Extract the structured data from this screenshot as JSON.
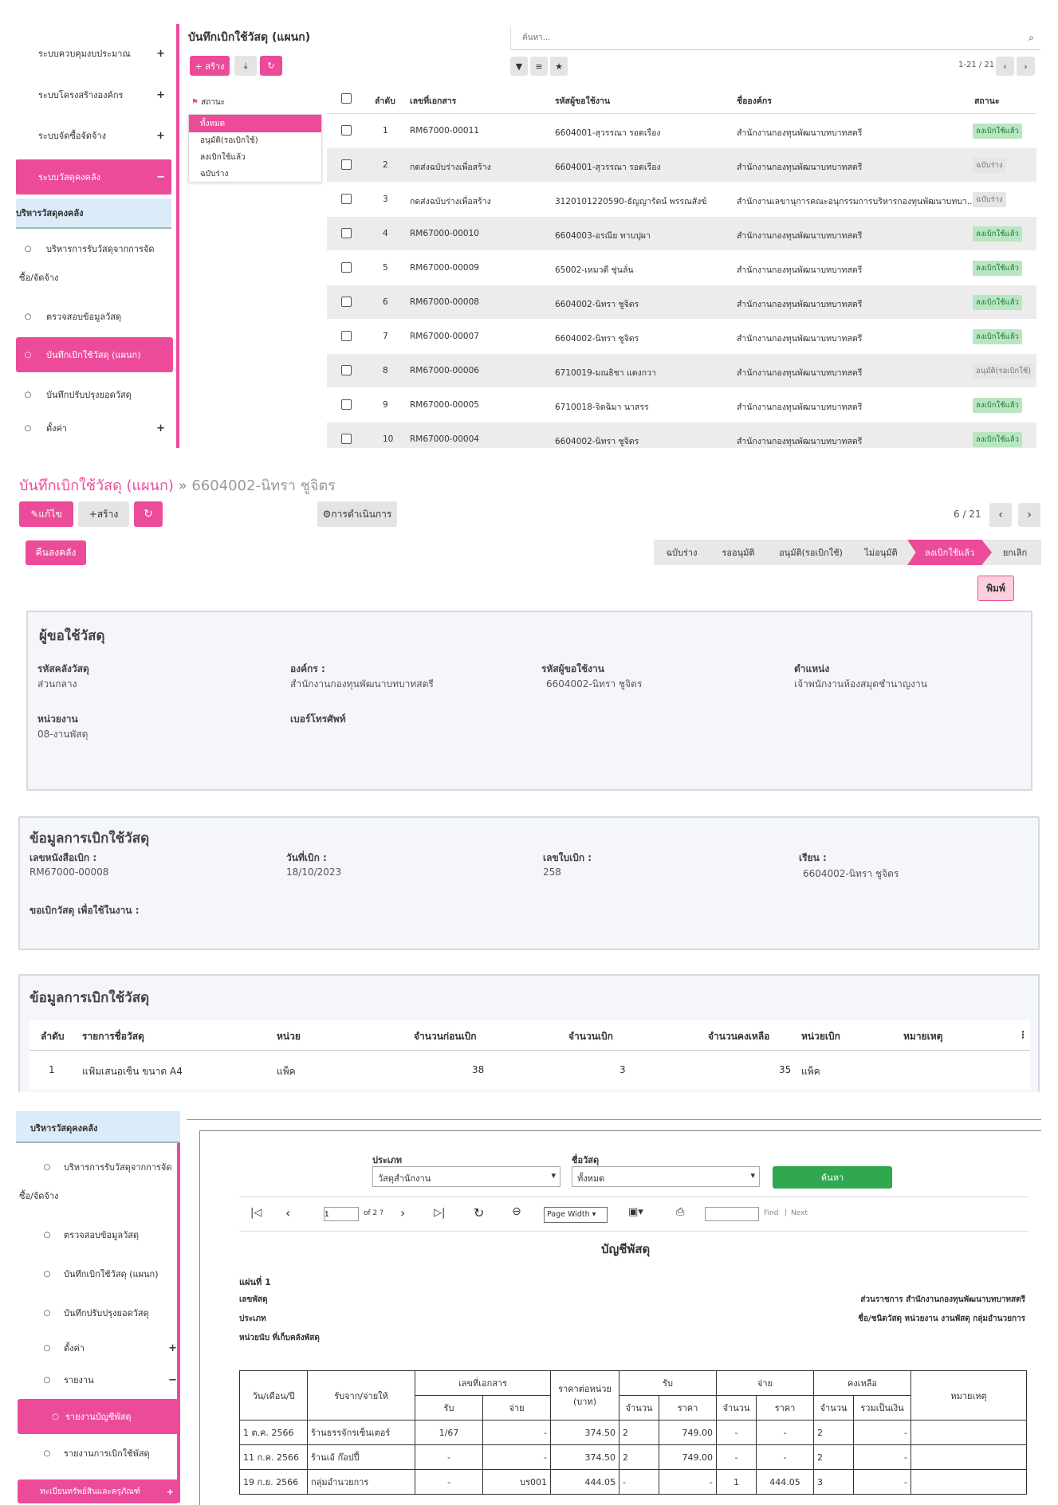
{
  "screen1": {
    "sidebar": [
      {
        "label": "ระบบควบคุมงบประมาณ",
        "sign": "+"
      },
      {
        "label": "ระบบโครงสร้างองค์กร",
        "sign": "+"
      },
      {
        "label": "ระบบจัดซื้อจัดจ้าง",
        "sign": "+"
      },
      {
        "label": "ระบบวัสดุคงคลัง",
        "sign": "−"
      }
    ],
    "sub_header": "บริหารวัสดุคงคลัง",
    "sub_items": [
      "บริหารการรับวัสดุจากการจัด",
      "ซื้อ/จัดจ้าง",
      "ตรวจสอบข้อมูลวัสดุ",
      "บันทึกเบิกใช้วัสดุ (แผนก)",
      "บันทึกปรับปรุงยอดวัสดุ",
      "ตั้งค่า"
    ],
    "title": "บันทึกเบิกใช้วัสดุ (แผนก)",
    "search_placeholder": "ค้นหา...",
    "create_label": "+ สร้าง",
    "pager": "1-21 / 21",
    "status_title": "สถานะ",
    "status_items": [
      "ทั้งหมด",
      "อนุมัติ(รอเบิกใช้)",
      "ลงเบิกใช้แล้ว",
      "ฉบับร่าง"
    ],
    "columns": [
      "ลำดับ",
      "เลขที่เอกสาร",
      "รหัสผู้ขอใช้งาน",
      "ชื่อองค์กร",
      "สถานะ"
    ],
    "rows": [
      {
        "n": "1",
        "doc": "RM67000-00011",
        "user": "6604001-สุวรรณา รอดเรือง",
        "org": "สำนักงานกองทุนพัฒนาบทบาทสตรี",
        "status": "ลงเบิกใช้แล้ว",
        "kind": "ok"
      },
      {
        "n": "2",
        "doc": "กดส่งฉบับร่างเพื่อสร้าง",
        "user": "6604001-สุวรรณา รอดเรือง",
        "org": "สำนักงานกองทุนพัฒนาบทบาทสตรี",
        "status": "ฉบับร่าง",
        "kind": "dr"
      },
      {
        "n": "3",
        "doc": "กดส่งฉบับร่างเพื่อสร้าง",
        "user": "3120101220590-ธัญญารัตน์ พรรณสังข์",
        "org": "สำนักงานเลขานุการคณะอนุกรรมการบริหารกองทุนพัฒนาบทบา...",
        "status": "ฉบับร่าง",
        "kind": "dr"
      },
      {
        "n": "4",
        "doc": "RM67000-00010",
        "user": "6604003-อรณีย ทาบปุผา",
        "org": "สำนักงานกองทุนพัฒนาบทบาทสตรี",
        "status": "ลงเบิกใช้แล้ว",
        "kind": "ok"
      },
      {
        "n": "5",
        "doc": "RM67000-00009",
        "user": "65002-เหมวดี ชุ่นลั่น",
        "org": "สำนักงานกองทุนพัฒนาบทบาทสตรี",
        "status": "ลงเบิกใช้แล้ว",
        "kind": "ok"
      },
      {
        "n": "6",
        "doc": "RM67000-00008",
        "user": "6604002-นิทรา ชูจิตร",
        "org": "สำนักงานกองทุนพัฒนาบทบาทสตรี",
        "status": "ลงเบิกใช้แล้ว",
        "kind": "ok"
      },
      {
        "n": "7",
        "doc": "RM67000-00007",
        "user": "6604002-นิทรา ชูจิตร",
        "org": "สำนักงานกองทุนพัฒนาบทบาทสตรี",
        "status": "ลงเบิกใช้แล้ว",
        "kind": "ok"
      },
      {
        "n": "8",
        "doc": "RM67000-00006",
        "user": "6710019-มณธิชา แดงกวา",
        "org": "สำนักงานกองทุนพัฒนาบทบาทสตรี",
        "status": "อนุมัติ(รอเบิกใช้)",
        "kind": "dr"
      },
      {
        "n": "9",
        "doc": "RM67000-00005",
        "user": "6710018-จิดฉิมา นาสรร",
        "org": "สำนักงานกองทุนพัฒนาบทบาทสตรี",
        "status": "ลงเบิกใช้แล้ว",
        "kind": "ok"
      },
      {
        "n": "10",
        "doc": "RM67000-00004",
        "user": "6604002-นิทรา ชูจิตร",
        "org": "สำนักงานกองทุนพัฒนาบทบาทสตรี",
        "status": "ลงเบิกใช้แล้ว",
        "kind": "ok"
      }
    ]
  },
  "screen2": {
    "breadcrumb_main": "บันทึกเบิกใช้วัสดุ (แผนก)",
    "breadcrumb_sep": "»",
    "breadcrumb_current": "6604002-นิทรา ชูจิตร",
    "edit_label": "แก้ไข",
    "create_label": "สร้าง",
    "action_label": "การดำเนินการ",
    "pager": "6 / 21",
    "return_label": "คืนลงคลัง",
    "print_label": "พิมพ์",
    "steps": [
      "ฉบับร่าง",
      "รออนุมัติ",
      "อนุมัติ(รอเบิกใช้)",
      "ไม่อนุมัติ",
      "ลงเบิกใช้แล้ว",
      "ยกเลิก"
    ],
    "requester_title": "ผู้ขอใช้วัสดุ",
    "f_store": "รหัสคลังวัสดุ",
    "v_store": "ส่วนกลาง",
    "f_org": "องค์กร :",
    "v_org": "สำนักงานกองทุนพัฒนาบทบาทสตรี",
    "f_user": "รหัสผู้ขอใช้งาน",
    "v_user": "6604002-นิทรา ชูจิตร",
    "f_pos": "ตำแหน่ง",
    "v_pos": "เจ้าพนักงานห้องสมุดชำนาญงาน",
    "f_unit": "หน่วยงาน",
    "v_unit": "08-งานพัสดุ",
    "f_phone": "เบอร์โทรศัพท์",
    "info_title": "ข้อมูลการเบิกใช้วัสดุ",
    "f_docno": "เลขหนังสือเบิก :",
    "v_docno": "RM67000-00008",
    "f_date": "วันที่เบิก :",
    "v_date": "18/10/2023",
    "f_slip": "เลขใบเบิก :",
    "v_slip": "258",
    "f_to": "เรียน :",
    "v_to": "6604002-นิทรา ชูจิตร",
    "f_purpose": "ขอเบิกวัสดุ เพื่อใช้ในงาน :",
    "items_title": "ข้อมูลการเบิกใช้วัสดุ",
    "item_cols": [
      "ลำดับ",
      "รายการชื่อวัสดุ",
      "หน่วย",
      "จำนวนก่อนเบิก",
      "จำนวนเบิก",
      "จำนวนคงเหลือ",
      "หน่วยเบิก",
      "หมายเหตุ"
    ],
    "item": {
      "n": "1",
      "name": "แฟ้มเสนอเซ็น ขนาด A4",
      "unit": "แพ็ค",
      "before": "38",
      "qty": "3",
      "left": "35",
      "unit2": "แพ็ค"
    }
  },
  "screen3": {
    "sub_header": "บริหารวัสดุคงคลัง",
    "items": [
      "บริหารการรับวัสดุจากการจัด",
      "ซื้อ/จัดจ้าง",
      "ตรวจสอบข้อมูลวัสดุ",
      "บันทึกเบิกใช้วัสดุ (แผนก)",
      "บันทึกปรับปรุงยอดวัสดุ",
      "ตั้งค่า",
      "รายงาน",
      "รายงานบัญชีพัสดุ",
      "รายงานการเบิกใช้พัสดุ",
      "ทะเบียนทรัพย์สินและครุภัณฑ์"
    ],
    "f_type": "ประเภท",
    "v_type": "วัสดุสำนักงาน",
    "f_name": "ชื่อวัสดุ",
    "v_name": "ทั้งหมด",
    "search_btn": "ค้นหา",
    "page_value": "1",
    "page_of": "of 2 ?",
    "zoom": "Page Width",
    "find": "Find",
    "next": "Next",
    "report_title": "บัญชีพัสดุ",
    "sheet": "แผ่นที่ 1",
    "l1": "เลขพัสดุ",
    "l2": "ประเภท",
    "l3": "หน่วยนับ  ที่เก็บคลังพัสดุ",
    "r1": "ส่วนราชการ สำนักงานกองทุนพัฒนาบทบาทสตรี",
    "r2": "ชื่อ/ชนิดวัสดุ  หน่วยงาน งานพัสดุ กลุ่มอำนวยการ",
    "h": {
      "date": "วัน/เดือน/ปี",
      "from": "รับจาก/จ่ายให้",
      "doc": "เลขที่เอกสาร",
      "price": "ราคาต่อหน่วย",
      "baht": "(บาท)",
      "recv": "รับ",
      "pay": "จ่าย",
      "bal": "คงเหลือ",
      "note": "หมายเหตุ",
      "r": "รับ",
      "p": "จ่าย",
      "qty": "จำนวน",
      "amt": "ราคา",
      "total": "รวมเป็นเงิน"
    },
    "rows": [
      {
        "date": "1 ต.ค. 2566",
        "from": "ร้านธรรจักรเซ็นเตอร์",
        "dr": "1/67",
        "dp": "-",
        "price": "374.50",
        "rq": "2",
        "ra": "749.00",
        "pq": "-",
        "pa": "-",
        "bq": "2",
        "bt": "-"
      },
      {
        "date": "11 ก.ค. 2566",
        "from": "ร้านเอ้ ก๊อปปี้",
        "dr": "-",
        "dp": "-",
        "price": "374.50",
        "rq": "2",
        "ra": "749.00",
        "pq": "-",
        "pa": "-",
        "bq": "2",
        "bt": "-"
      },
      {
        "date": "19 ก.ย. 2566",
        "from": "กลุ่มอำนวยการ",
        "dr": "-",
        "dp": "บร001",
        "price": "444.05",
        "rq": "-",
        "ra": "-",
        "pq": "1",
        "pa": "444.05",
        "bq": "3",
        "bt": "-"
      }
    ]
  },
  "colors": {
    "accent": "#ec4b9a",
    "light": "#dcebfa",
    "ok": "#b9e6c2",
    "green": "#2fa84f"
  }
}
